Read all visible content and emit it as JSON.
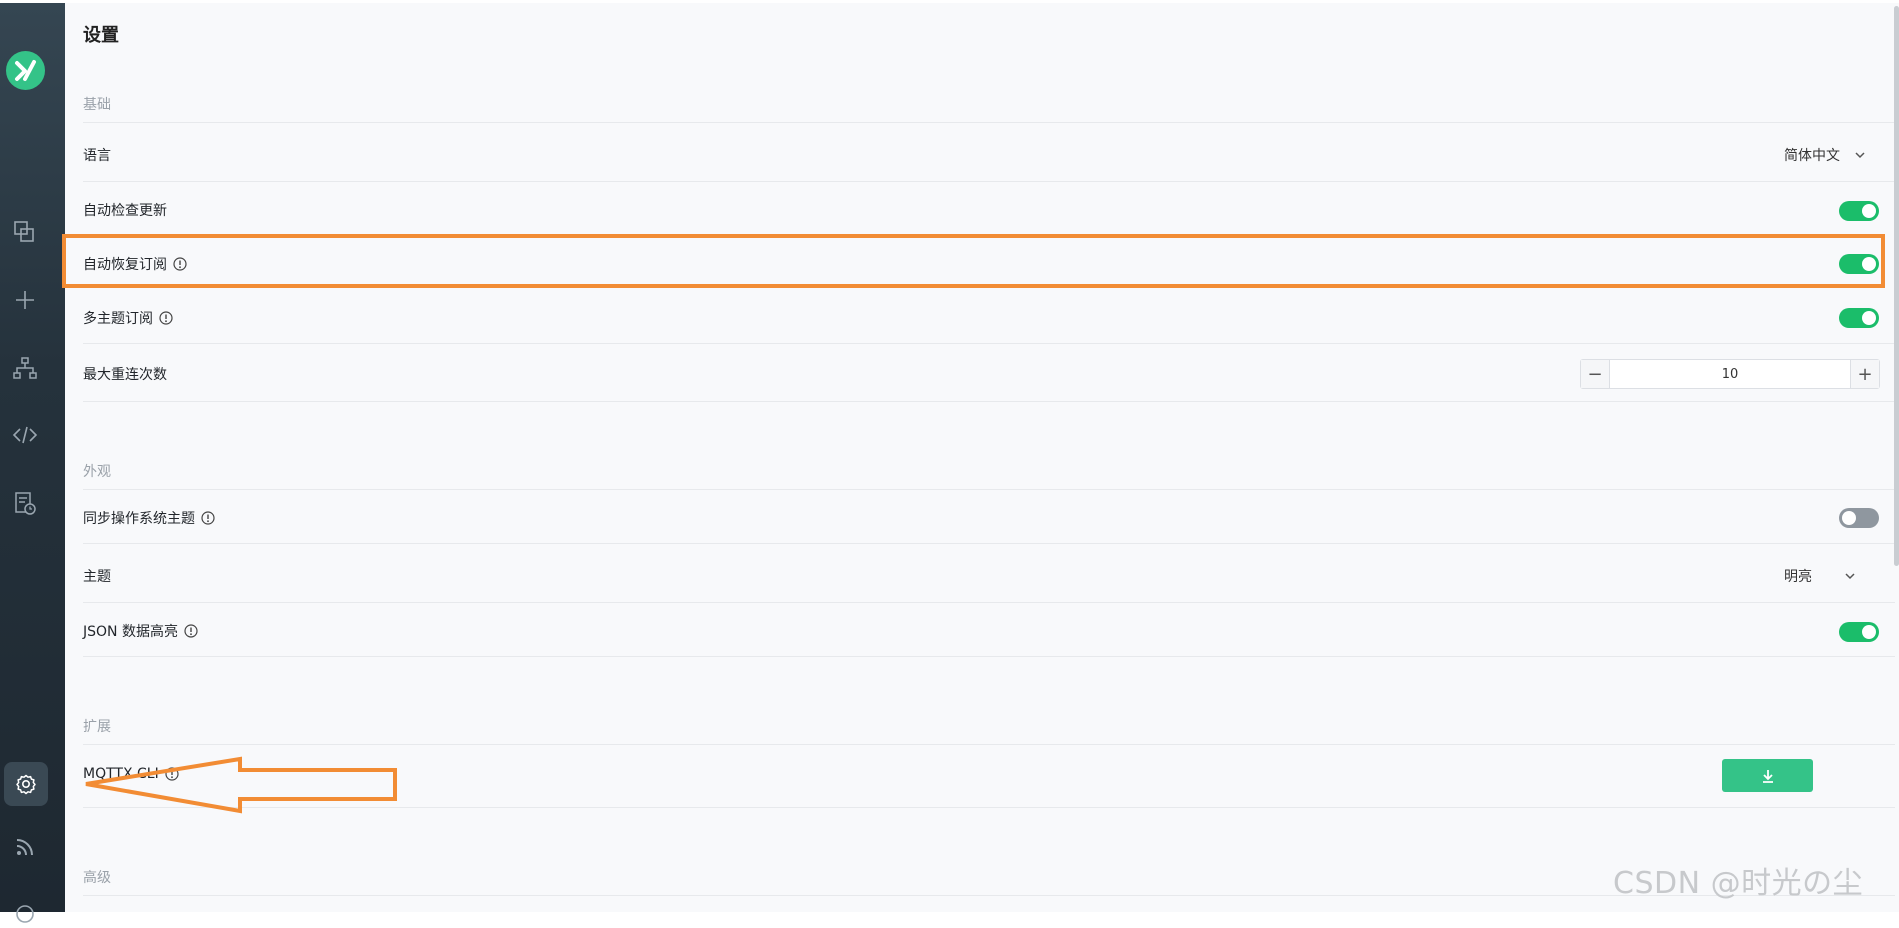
{
  "colors": {
    "accent": "#1bbd6a",
    "brand": "#34c388",
    "annotation": "#f28c34",
    "sidebar": "#25323c"
  },
  "sidebar": {
    "logo_icon": "mqttx-logo",
    "items": [
      {
        "icon": "connections-icon"
      },
      {
        "icon": "plus-icon"
      },
      {
        "icon": "topology-icon"
      },
      {
        "icon": "code-icon"
      },
      {
        "icon": "log-icon"
      },
      {
        "icon": "gear-icon",
        "active": true
      },
      {
        "icon": "rss-icon"
      }
    ]
  },
  "page": {
    "title": "设置"
  },
  "sections": {
    "basic": {
      "title": "基础",
      "language_label": "语言",
      "language_value": "简体中文",
      "auto_check_update_label": "自动检查更新",
      "auto_check_update": true,
      "auto_resubscribe_label": "自动恢复订阅",
      "auto_resubscribe": true,
      "multi_topics_label": "多主题订阅",
      "multi_topics": true,
      "max_reconnect_label": "最大重连次数",
      "max_reconnect_value": "10",
      "minus_glyph": "−",
      "plus_glyph": "+"
    },
    "appearance": {
      "title": "外观",
      "sync_os_theme_label": "同步操作系统主题",
      "sync_os_theme": false,
      "theme_label": "主题",
      "theme_value": "明亮",
      "json_highlight_label": "JSON 数据高亮",
      "json_highlight": true
    },
    "extension": {
      "title": "扩展",
      "cli_label": "MQTTX CLI",
      "download_icon": "download-icon"
    },
    "advanced": {
      "title": "高级"
    }
  },
  "watermark": "CSDN @时光の尘"
}
